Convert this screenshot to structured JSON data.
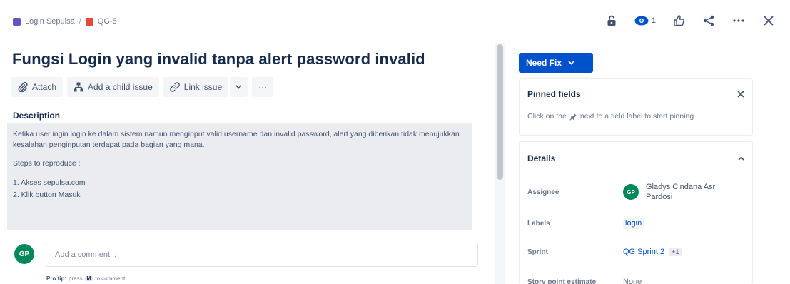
{
  "breadcrumb": {
    "project": "Login Sepulsa",
    "separator": "/",
    "issue": "QG-5"
  },
  "header": {
    "watch_count": "1"
  },
  "issue": {
    "title": "Fungsi Login yang invalid tanpa alert password invalid"
  },
  "toolbar": {
    "attach": "Attach",
    "add_child": "Add a child issue",
    "link_issue": "Link issue",
    "more": "···"
  },
  "description": {
    "label": "Description",
    "para1": "Ketika user ingin login ke dalam sistem namun menginput valid username dan invalid password, alert yang diberikan tidak menujukkan kesalahan penginputan terdapat pada bagian yang mana.",
    "para2": "Steps to reproduce :",
    "step1": "1. Akses sepulsa.com",
    "step2": "2. Klik button Masuk"
  },
  "comment": {
    "avatar_initials": "GP",
    "placeholder": "Add a comment...",
    "protip_label": "Pro tip:",
    "protip_press": "press",
    "protip_key": "M",
    "protip_suffix": "to comment"
  },
  "status": {
    "label": "Need Fix"
  },
  "pinned": {
    "title": "Pinned fields",
    "hint_before": "Click on the",
    "hint_after": "next to a field label to start pinning."
  },
  "details": {
    "title": "Details",
    "assignee_label": "Assignee",
    "assignee_initials": "GP",
    "assignee_name": "Gladys Cindana Asri Pardosi",
    "labels_label": "Labels",
    "labels_value": "login",
    "sprint_label": "Sprint",
    "sprint_value": "QG Sprint 2",
    "sprint_more": "+1",
    "estimate_label": "Story point estimate",
    "estimate_value": "None"
  },
  "colors": {
    "accent": "#0052cc",
    "avatar": "#00875a",
    "project_icon": "#6554c0",
    "issue_icon": "#e5493a"
  }
}
